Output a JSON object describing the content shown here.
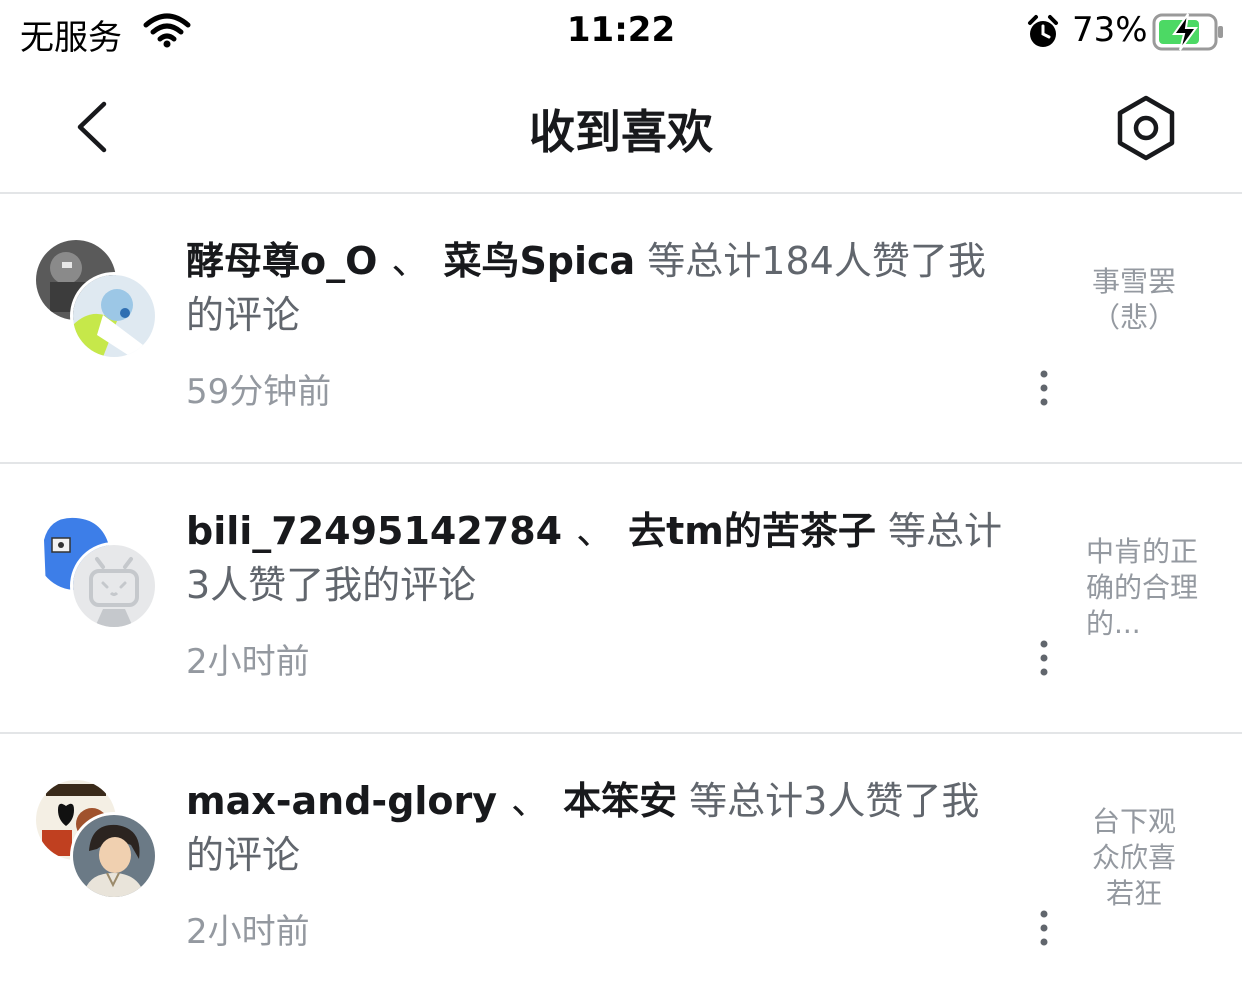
{
  "status_bar": {
    "carrier": "无服务",
    "time": "11:22",
    "battery": "73%"
  },
  "nav": {
    "title": "收到喜欢",
    "icons": {
      "back": "chevron-left-icon",
      "settings": "settings-hexagon-icon"
    }
  },
  "items": [
    {
      "user1": "酵母尊o_O",
      "sep": "、",
      "user2": "菜鸟Spica",
      "desc": "等总计184人赞了我的评论",
      "time": "59分钟前",
      "quote": "事雪罢（悲）"
    },
    {
      "user1": "bili_72495142784",
      "sep": "、",
      "user2": "去tm的苦茶子",
      "desc": "等总计3人赞了我的评论",
      "time": "2小时前",
      "quote": "中肯的正确的合理的..."
    },
    {
      "user1": "max-and-glory",
      "sep": "、",
      "user2": "本笨安",
      "desc": "等总计3人赞了我的评论",
      "time": "2小时前",
      "quote": "台下观众欣喜若狂"
    }
  ],
  "colors": {
    "divider": "#e3e5e7",
    "text_primary": "#18191c",
    "text_secondary": "#61666d",
    "text_tertiary": "#9499a0",
    "battery_green": "#4cd964"
  }
}
